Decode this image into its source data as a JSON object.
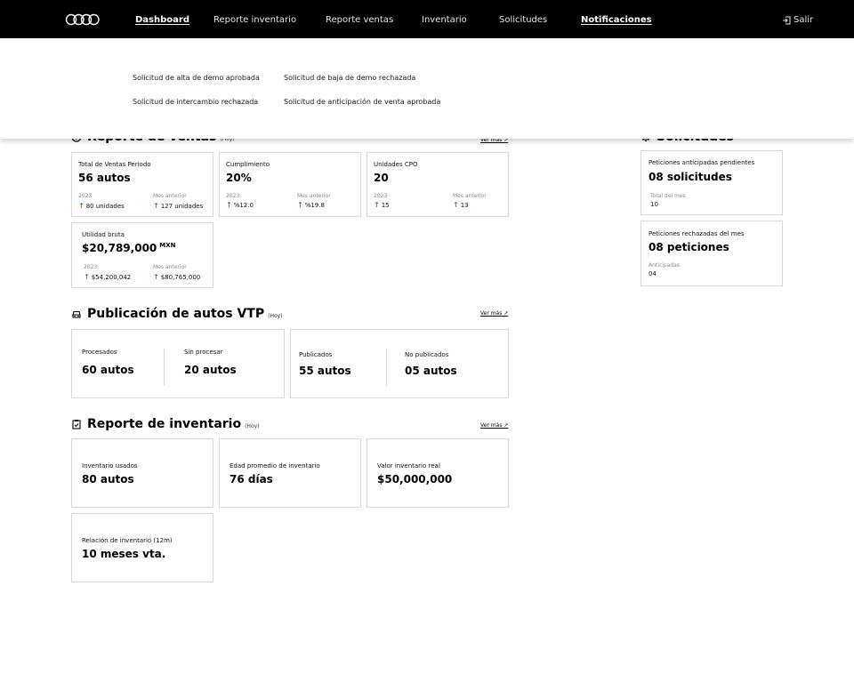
{
  "nav": {
    "items": [
      {
        "label": "Dashboard",
        "active": true
      },
      {
        "label": "Reporte inventario",
        "active": false
      },
      {
        "label": "Reporte ventas",
        "active": false
      },
      {
        "label": "Inventario",
        "active": false
      },
      {
        "label": "Solicitudes",
        "active": false
      },
      {
        "label": "Notificaciones",
        "active": true
      }
    ],
    "logout_label": "Salir"
  },
  "notifications": [
    "Solicitud de alta de demo aprobada",
    "Solicitud de baja de demo rechazada",
    "Solicitud de intercambio rechazada",
    "Solicitud de anticipación de venta aprobada"
  ],
  "sales": {
    "title": "Reporte de ventas",
    "hoy": "(Hoy)",
    "ver_mas": "Ver más ↗",
    "cards": [
      {
        "label": "Total de Ventas Periodo",
        "value": "56 autos",
        "c1_label": "2023",
        "c1_value": "80 unidades",
        "c2_label": "Mes anterior",
        "c2_value": "127 unidades"
      },
      {
        "label": "Cumplimiento",
        "value": "20%",
        "c1_label": "2023",
        "c1_value": "%12.0",
        "c2_label": "Mes anterior",
        "c2_value": "%19.8"
      },
      {
        "label": "Unidades CPO",
        "value": "20",
        "c1_label": "2023",
        "c1_value": "15",
        "c2_label": "Mes anterior",
        "c2_value": "13"
      },
      {
        "label": "Utilidad bruta",
        "value": "$20,789,000",
        "unit": "MXN",
        "c1_label": "2023",
        "c1_value": "$54,200,042",
        "c2_label": "Mes anterior",
        "c2_value": "$80,765,000"
      }
    ]
  },
  "requests": {
    "title": "Solicitudes",
    "cards": [
      {
        "label": "Peticiones anticipadas pendientes",
        "value": "08 solicitudes",
        "sub_label": "Total del mes",
        "sub_value": "10"
      },
      {
        "label": "Peticiones rechazadas del mes",
        "value": "08 peticiones",
        "sub_label": "Anticipadas",
        "sub_value": "04"
      }
    ]
  },
  "vtp": {
    "title": "Publicación de autos VTP",
    "hoy": "(Hoy)",
    "ver_mas": "Ver más ↗",
    "items": [
      {
        "label": "Procesados",
        "value": "60 autos"
      },
      {
        "label": "Sin procesar",
        "value": "20 autos"
      },
      {
        "label": "Publicados",
        "value": "55 autos"
      },
      {
        "label": "No publicados",
        "value": "05 autos"
      }
    ]
  },
  "inventory": {
    "title": "Reporte de inventario",
    "hoy": "(Hoy)",
    "ver_mas": "Ver más ↗",
    "cards": [
      {
        "label": "Inventario usados",
        "value": "80 autos"
      },
      {
        "label": "Edad promedio de inventario",
        "value": "76 días"
      },
      {
        "label": "Valor inventario real",
        "value": "$50,000,000"
      },
      {
        "label": "Relación de inventario (12m)",
        "value": "10 meses vta."
      }
    ]
  },
  "colors": {
    "topbar": "#000000",
    "up_arrow": "#2e9e3e",
    "border": "#d9d9d9"
  }
}
